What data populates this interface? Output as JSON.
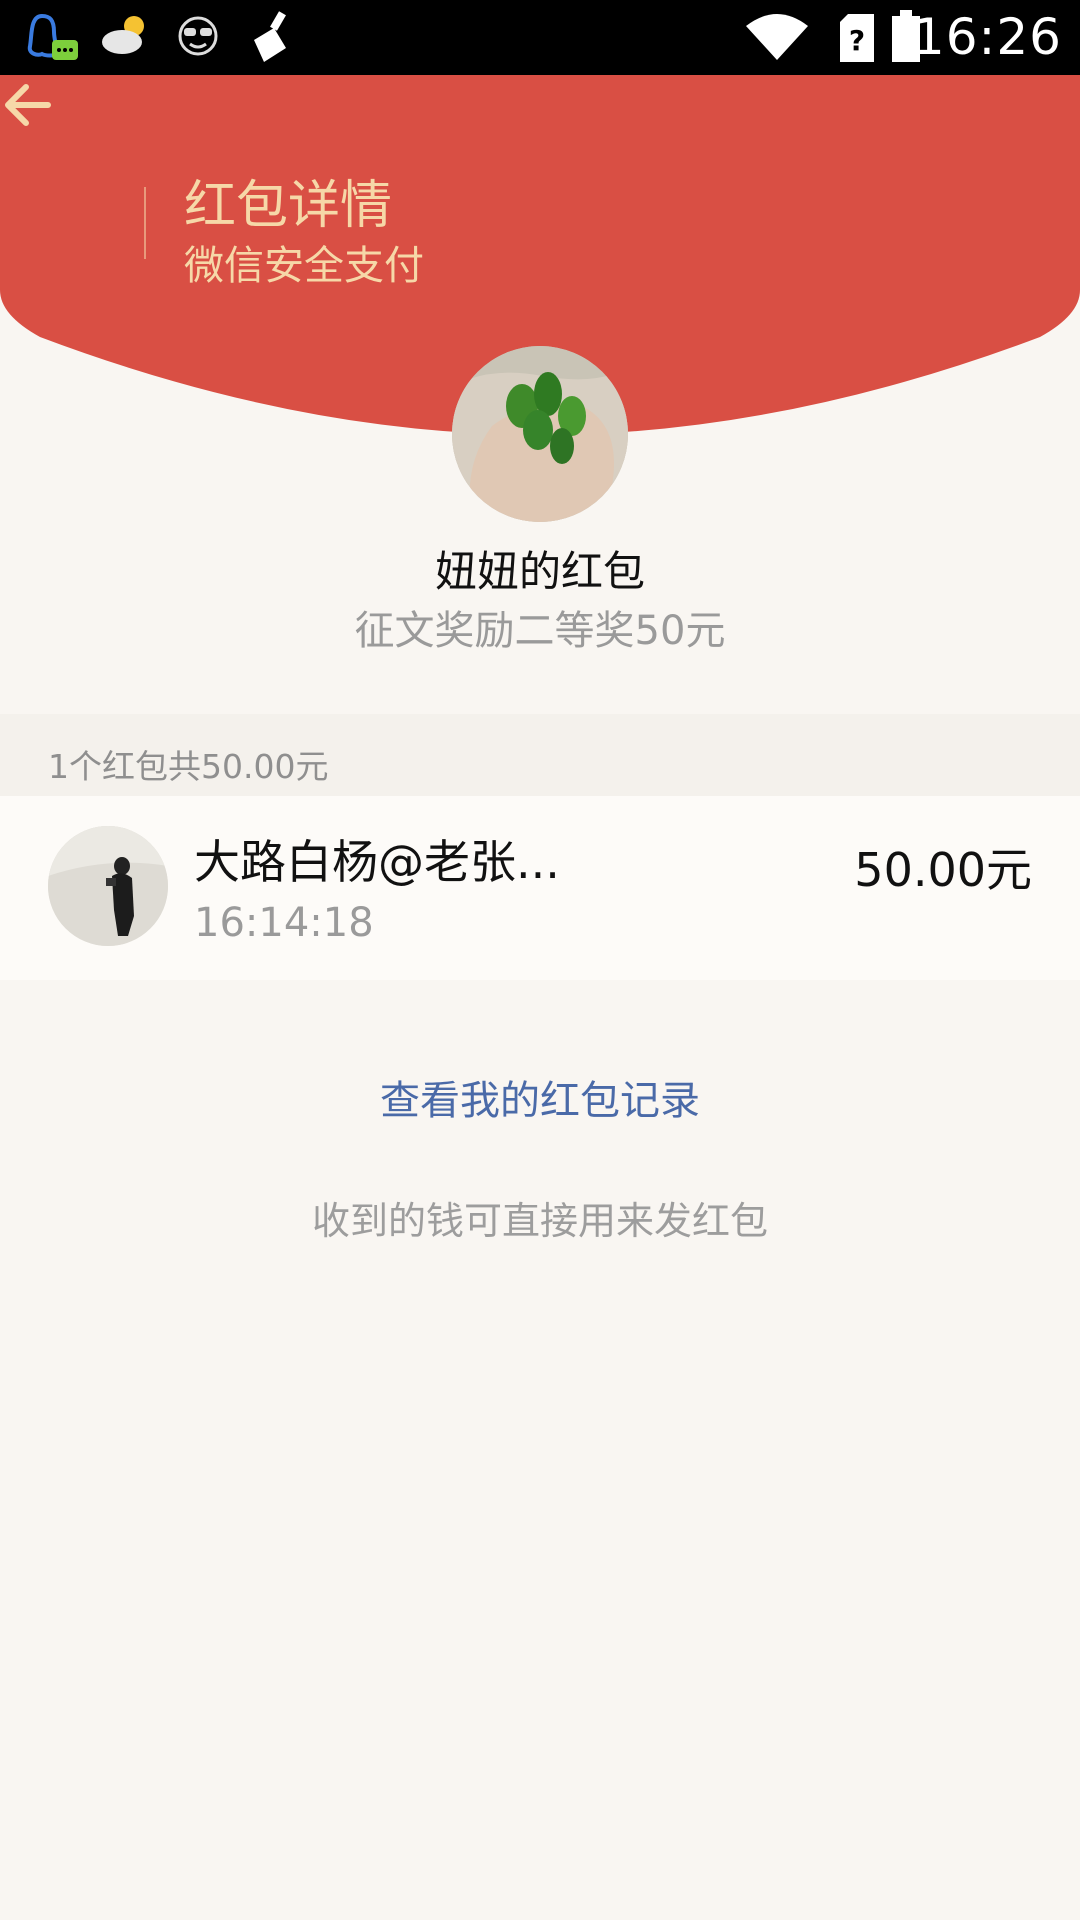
{
  "status_bar": {
    "time": "16:26",
    "icons": [
      "qq-icon",
      "weather-cloudy-icon",
      "sunglasses-face-icon",
      "cleaner-broom-icon",
      "wifi-icon",
      "sim-unknown-icon",
      "battery-icon"
    ]
  },
  "header": {
    "title": "红包详情",
    "subtitle": "微信安全支付",
    "color": "#d94f44",
    "text_color": "#f6d8a8"
  },
  "packet": {
    "sender_name": "妞妞的红包",
    "blessing": "征文奖励二等奖50元"
  },
  "summary": {
    "text": "1个红包共50.00元"
  },
  "records": [
    {
      "name": "大路白杨@老张...",
      "time": "16:14:18",
      "amount": "50.00元"
    }
  ],
  "links": {
    "my_records": "查看我的红包记录",
    "footnote": "收到的钱可直接用来发红包"
  }
}
